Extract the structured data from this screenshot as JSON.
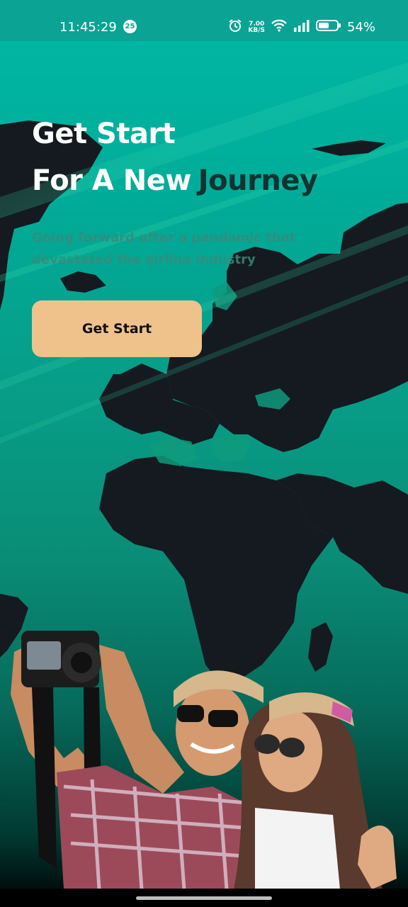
{
  "status_bar": {
    "time": "11:45:29",
    "notification_count": "25",
    "speed_value": "7.00",
    "speed_unit": "KB/S",
    "battery": "54%"
  },
  "hero": {
    "title_line1": "Get Start",
    "title_line2": "For A New",
    "title_highlight": "Journey",
    "subtitle": "Going forward after a pandamic that devastated the airline industry",
    "button_label": "Get Start"
  },
  "colors": {
    "background_top": "#00b8a5",
    "highlight_text": "#123330",
    "button_bg": "#efc28c",
    "map_fill": "#141a1f"
  }
}
